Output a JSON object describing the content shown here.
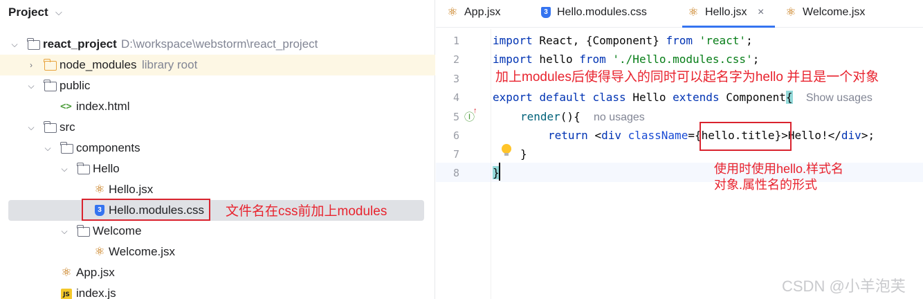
{
  "project_panel": {
    "title": "Project",
    "tree": [
      {
        "label": "react_project",
        "hint": "D:\\workspace\\webstorm\\react_project",
        "icon": "folder-icon"
      },
      {
        "label": "node_modules",
        "hint": "library root",
        "icon": "library-folder-icon"
      },
      {
        "label": "public",
        "icon": "folder-icon"
      },
      {
        "label": "index.html",
        "icon": "html-file-icon"
      },
      {
        "label": "src",
        "icon": "folder-icon"
      },
      {
        "label": "components",
        "icon": "folder-icon"
      },
      {
        "label": "Hello",
        "icon": "folder-icon"
      },
      {
        "label": "Hello.jsx",
        "icon": "react-file-icon"
      },
      {
        "label": "Hello.modules.css",
        "icon": "css-file-icon"
      },
      {
        "label": "Welcome",
        "icon": "folder-icon"
      },
      {
        "label": "Welcome.jsx",
        "icon": "react-file-icon"
      },
      {
        "label": "App.jsx",
        "icon": "react-file-icon"
      },
      {
        "label": "index.js",
        "icon": "js-file-icon"
      }
    ],
    "annotation": "文件名在css前加上modules"
  },
  "tabs": [
    {
      "label": "App.jsx",
      "icon": "react-file-icon"
    },
    {
      "label": "Hello.modules.css",
      "icon": "css-file-icon"
    },
    {
      "label": "Hello.jsx",
      "icon": "react-file-icon",
      "active": true
    },
    {
      "label": "Welcome.jsx",
      "icon": "react-file-icon"
    }
  ],
  "editor": {
    "line_numbers": [
      "1",
      "2",
      "3",
      "4",
      "5",
      "6",
      "7",
      "8"
    ],
    "code": {
      "l1_import": "import",
      "l1_mid": " React, {Component} ",
      "l1_from": "from",
      "l1_str": "'react'",
      "l1_end": ";",
      "l2_import": "import",
      "l2_mid": " hello ",
      "l2_from": "from",
      "l2_str": "'./Hello.modules.css'",
      "l2_end": ";",
      "l4_export": "export",
      "l4_default": "default",
      "l4_class": "class",
      "l4_name": "Hello",
      "l4_extends": "extends",
      "l4_parent": "Component",
      "l4_brace": "{",
      "l4_hint": "Show usages",
      "l5_render": "render",
      "l5_rest": "(){",
      "l5_hint": "no usages",
      "l6_return": "return",
      "l6_lt": "<",
      "l6_div": "div",
      "l6_attr": "className",
      "l6_eq": "=",
      "l6_expr": "{hello.title}",
      "l6_text": ">Hello!</",
      "l6_div2": "div",
      "l6_end": ">;",
      "l7": "}",
      "l8": "}"
    },
    "annotation_line3": "加上modules后使得导入的同时可以起名字为hello 并且是一个对象",
    "annotation_usage_1": "使用时使用hello.样式名",
    "annotation_usage_2": "对象.属性名的形式"
  },
  "watermark": "CSDN @小羊泡芙"
}
